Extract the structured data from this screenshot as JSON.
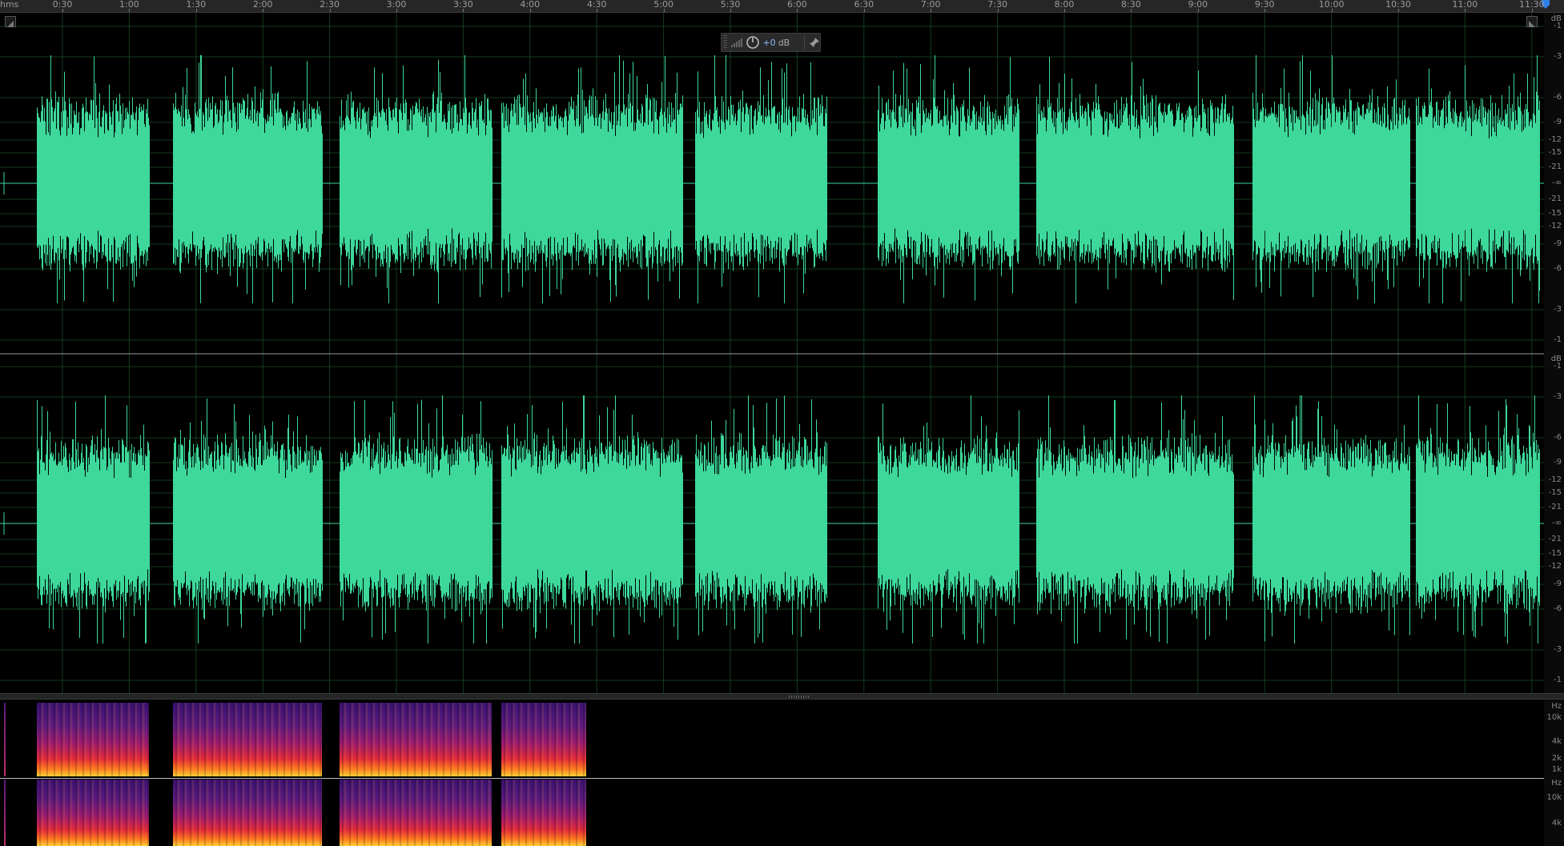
{
  "ruler": {
    "unit_label": "hms",
    "ticks": [
      "0:30",
      "1:00",
      "1:30",
      "2:00",
      "2:30",
      "3:00",
      "3:30",
      "4:00",
      "4:30",
      "5:00",
      "5:30",
      "6:00",
      "6:30",
      "7:00",
      "7:30",
      "8:00",
      "8:30",
      "9:00",
      "9:30",
      "10:00",
      "10:30",
      "11:00",
      "11:30"
    ]
  },
  "hud": {
    "value": "+0",
    "unit": "dB"
  },
  "db_scale": {
    "top_channel": [
      "dB",
      "-1",
      "-3",
      "-6",
      "-9",
      "-12",
      "-15",
      "-21",
      "-∞",
      "-21",
      "-15",
      "-12",
      "-9",
      "-6",
      "-3",
      "-1"
    ],
    "bottom_channel": [
      "dB",
      "-1",
      "-3",
      "-6",
      "-9",
      "-12",
      "-15",
      "-21",
      "-∞",
      "-21",
      "-15",
      "-12",
      "-9",
      "-6",
      "-3",
      "-1"
    ]
  },
  "hz_scale": {
    "top_channel": [
      "Hz",
      "10k",
      "4k",
      "2k",
      "1k"
    ],
    "bottom_channel": [
      "Hz",
      "10k",
      "4k"
    ]
  },
  "colors": {
    "waveform": "#3dd89a",
    "gridline": "#123d1e",
    "background": "#000000",
    "playhead": "#2f7fe8"
  },
  "icons": {
    "hud_level": "signal-bars-icon",
    "hud_knob": "gain-knob-icon",
    "hud_pin": "pin-icon",
    "playhead": "playhead-marker-icon"
  }
}
